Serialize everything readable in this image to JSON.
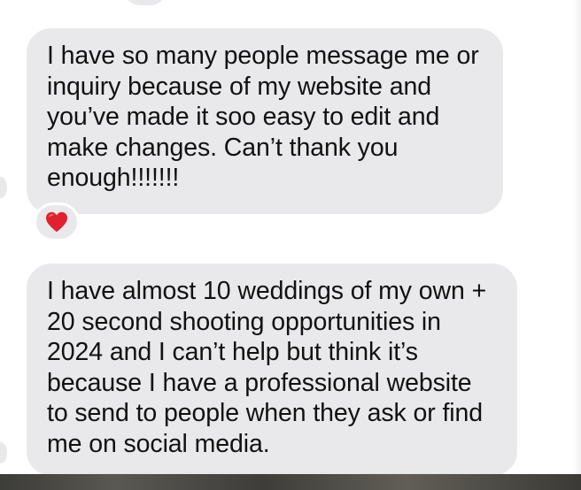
{
  "messages": [
    {
      "text": "I have so many people message me or\ninquiry because of my website and\nyou’ve made it soo easy to edit and\nmake changes. Can’t thank you\nenough!!!!!!!"
    },
    {
      "text": "I have almost 10 weddings of my own +\n20 second shooting opportunities in\n2024 and I can’t help but think it’s\nbecause I have a professional website\nto send to people when they ask or find\nme on social media."
    }
  ],
  "reaction": {
    "icon": "heart-icon",
    "color": "#e0212f"
  },
  "colors": {
    "bubble": "#e9e9eb",
    "text": "#111111",
    "background": "#ffffff"
  }
}
